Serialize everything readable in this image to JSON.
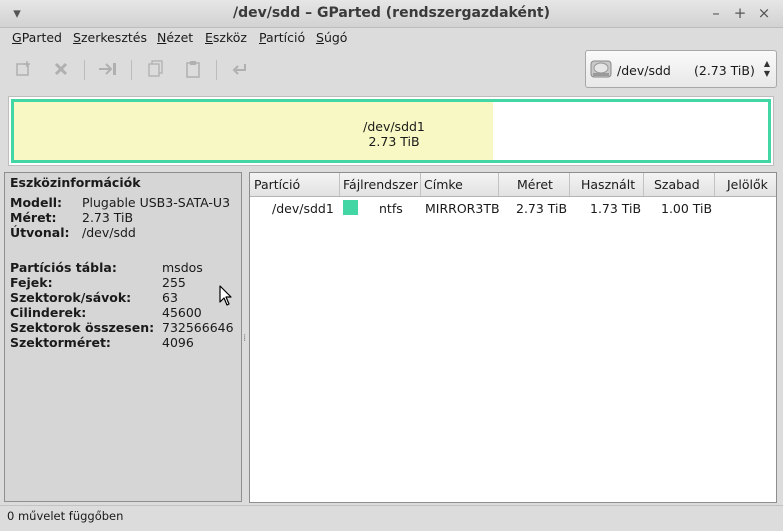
{
  "window": {
    "title": "/dev/sdd – GParted (rendszergazdaként)"
  },
  "wm_buttons": {
    "menu": "▾",
    "minimize": "–",
    "maximize": "+",
    "close": "×"
  },
  "menu": [
    {
      "mnemonic": "G",
      "rest": "Parted"
    },
    {
      "mnemonic": "S",
      "rest": "zerkesztés"
    },
    {
      "mnemonic": "N",
      "rest": "ézet"
    },
    {
      "mnemonic": "E",
      "rest": "szköz"
    },
    {
      "mnemonic": "P",
      "rest": "artíció"
    },
    {
      "mnemonic": "S",
      "rest": "úgó"
    }
  ],
  "toolbar": {
    "icons": [
      "new-partition-icon",
      "delete-icon",
      "resize-move-icon",
      "copy-icon",
      "paste-icon",
      "undo-icon"
    ]
  },
  "device_selector": {
    "device": "/dev/sdd",
    "size": "(2.73 TiB)"
  },
  "disk_map": {
    "partition": "/dev/sdd1",
    "size": "2.73 TiB",
    "used_fraction": 0.635,
    "border_color": "#42d6a4",
    "used_color": "#f8f8c4"
  },
  "device_info": {
    "heading": "Eszközinformációk",
    "rows": [
      {
        "label": "Modell:",
        "value": "Plugable USB3-SATA-U3"
      },
      {
        "label": "Méret:",
        "value": "2.73 TiB"
      },
      {
        "label": "Útvonal:",
        "value": "/dev/sdd"
      }
    ],
    "rows2": [
      {
        "label": "Partíciós tábla:",
        "value": "msdos"
      },
      {
        "label": "Fejek:",
        "value": "255"
      },
      {
        "label": "Szektorok/sávok:",
        "value": "63"
      },
      {
        "label": "Cilinderek:",
        "value": "45600"
      },
      {
        "label": "Szektorok összesen:",
        "value": "732566646"
      },
      {
        "label": "Szektorméret:",
        "value": "4096"
      }
    ]
  },
  "partition_table": {
    "columns": [
      "Partíció",
      "Fájlrendszer",
      "Címke",
      "Méret",
      "Használt",
      "Szabad",
      "Jelölők"
    ],
    "rows": [
      {
        "partition": "/dev/sdd1",
        "filesystem": "ntfs",
        "fs_color": "#42d6a4",
        "label": "MIRROR3TB",
        "size": "2.73 TiB",
        "used": "1.73 TiB",
        "free": "1.00 TiB",
        "flags": ""
      }
    ]
  },
  "status": {
    "text": "0 művelet függőben"
  }
}
